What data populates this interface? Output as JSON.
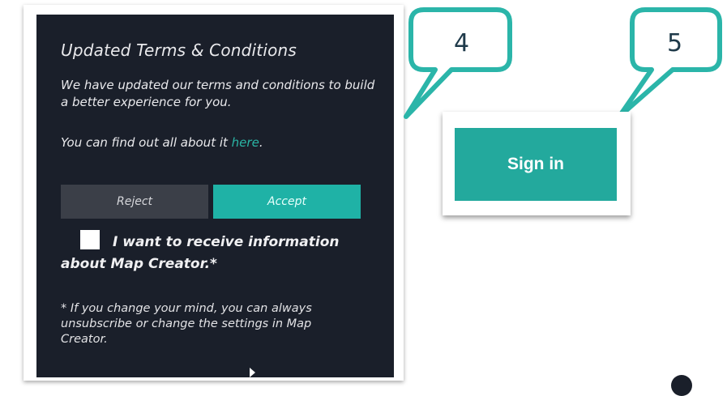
{
  "terms_dialog": {
    "title": "Updated Terms & Conditions",
    "body_line": "We have updated our terms and conditions to build a better experience for you.",
    "find_out_prefix": "You can find out all about it ",
    "find_out_link": "here",
    "find_out_suffix": ".",
    "reject_label": "Reject",
    "accept_label": "Accept",
    "checkbox_checked": false,
    "opt_in_label": "I want to receive information about Map Creator.*",
    "footnote": "* If you change your mind, you can always unsubscribe or change the settings in Map Creator."
  },
  "callouts": {
    "first": "4",
    "second": "5"
  },
  "signin": {
    "label": "Sign in"
  },
  "colors": {
    "panel_bg": "#1a1f2a",
    "accent_teal": "#1fb2a6",
    "reject_bg": "#3b3f48",
    "callout_border": "#2bb5a9"
  }
}
